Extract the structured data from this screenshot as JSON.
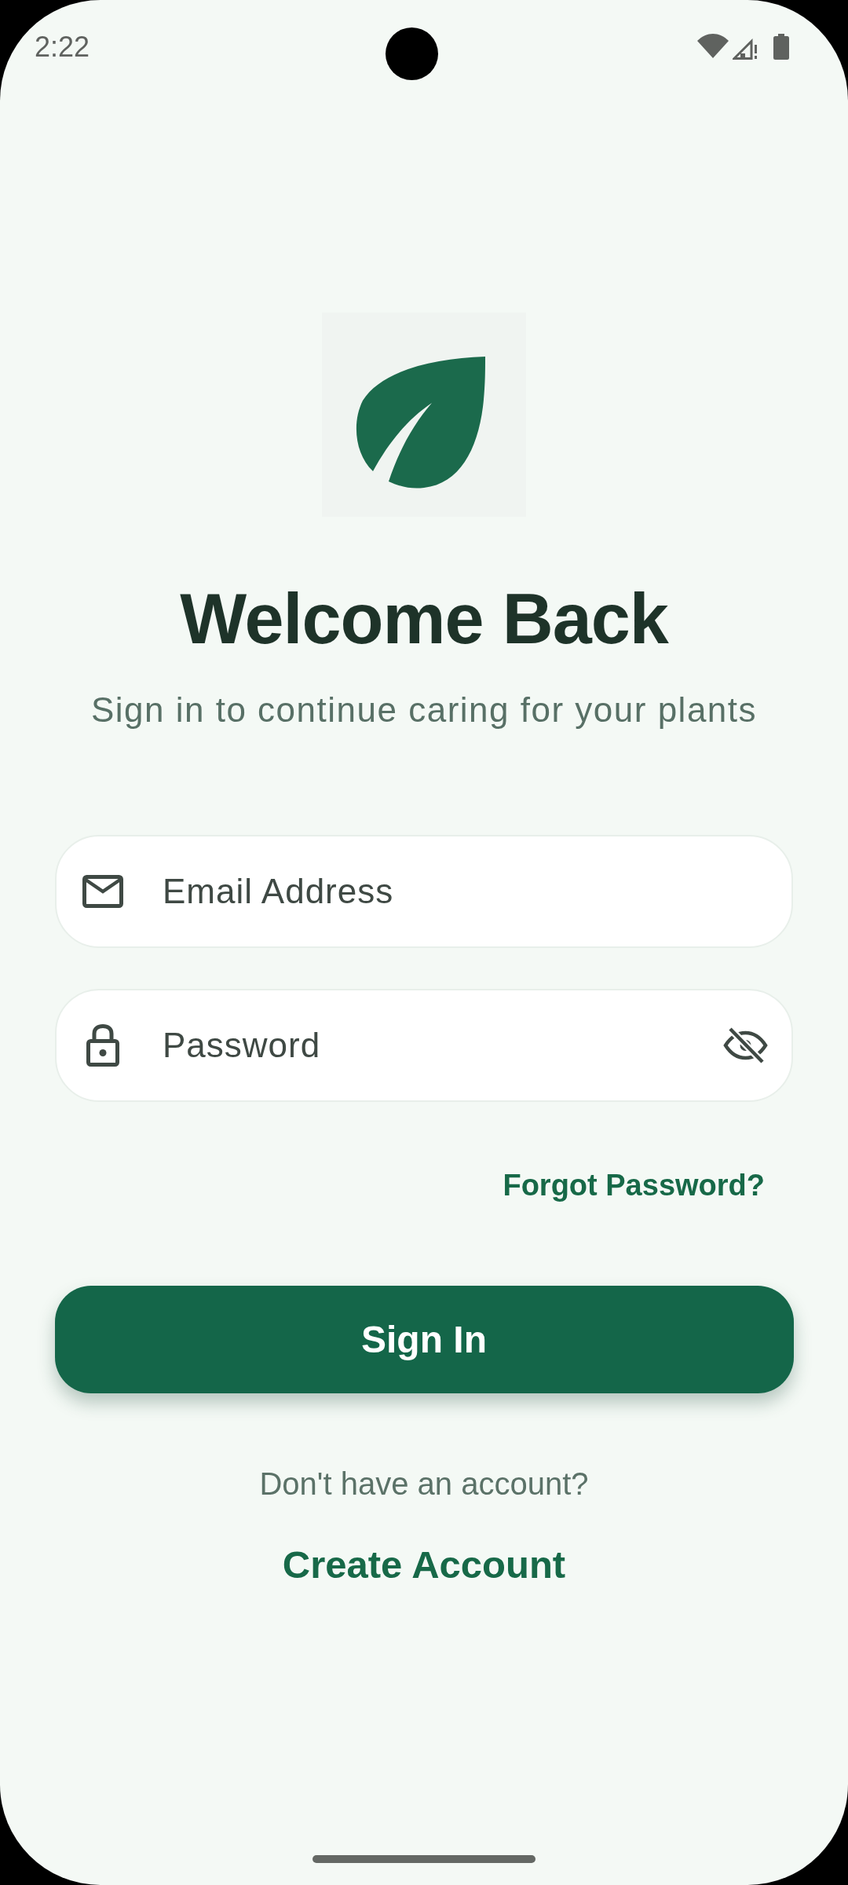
{
  "status_bar": {
    "time": "2:22"
  },
  "title": "Welcome Back",
  "subtitle": "Sign in to continue caring for your plants",
  "fields": [
    {
      "kind": "email",
      "placeholder": "Email Address"
    },
    {
      "kind": "password",
      "placeholder": "Password",
      "password_visible": false
    }
  ],
  "forgot_password_link": "Forgot Password?",
  "sign_in_button": "Sign In",
  "signup_prompt": "Don't have an account?",
  "create_account_link": "Create Account"
}
